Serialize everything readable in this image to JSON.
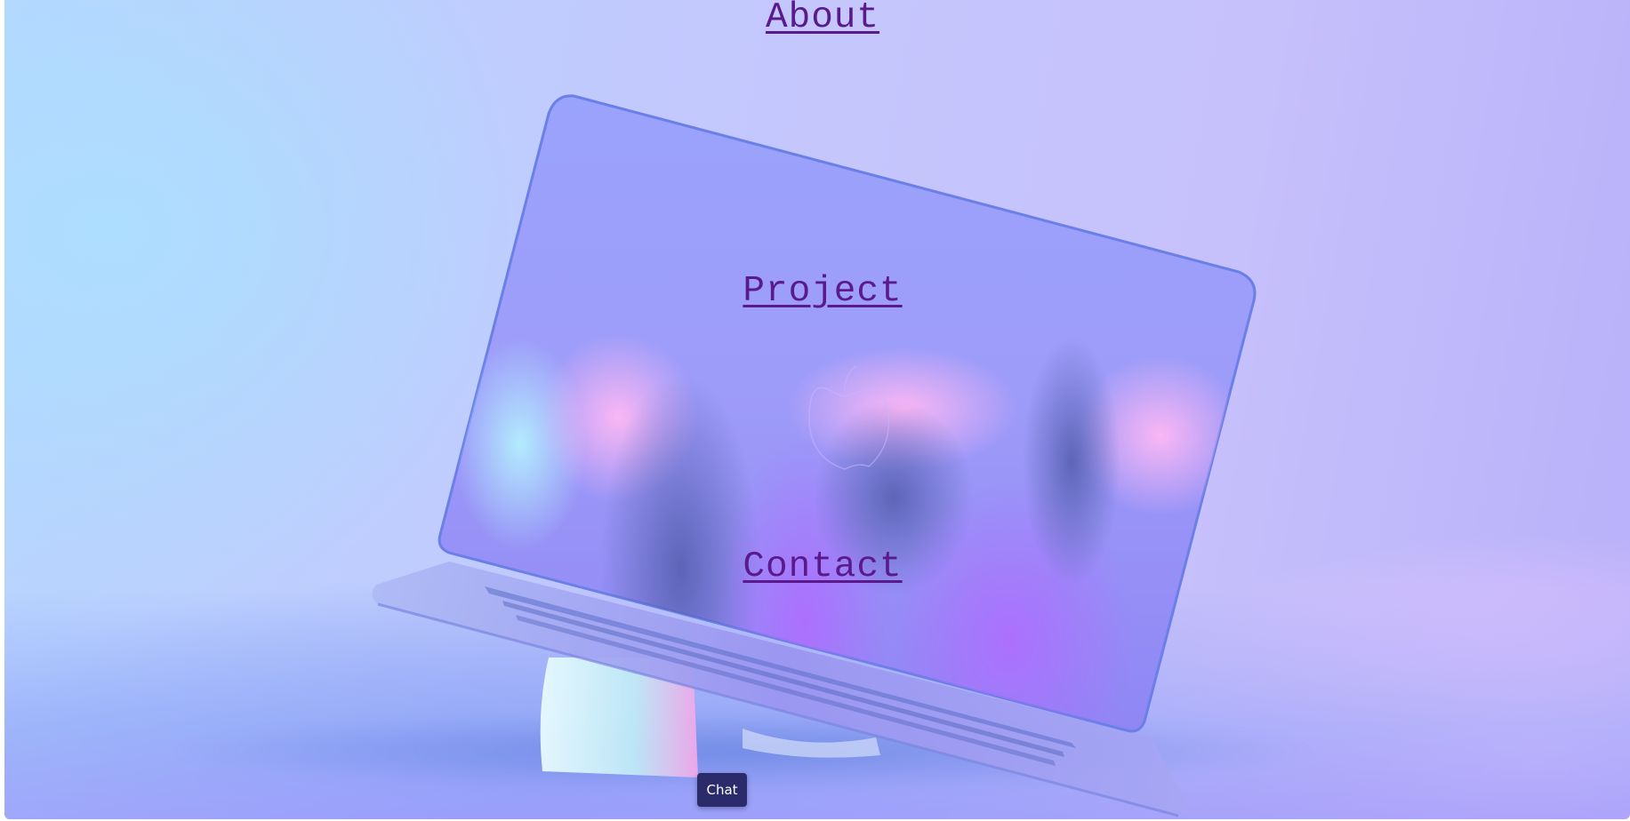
{
  "nav": {
    "about": "About",
    "project": "Project",
    "contact": "Contact"
  },
  "chat": {
    "label": "Chat"
  },
  "hero": {
    "image_icon": "laptop-illustration",
    "logo_icon": "apple-logo-icon"
  },
  "colors": {
    "link": "#5a1a8c",
    "chat_bg": "#2b2a6b",
    "chat_text": "#ffffff"
  }
}
